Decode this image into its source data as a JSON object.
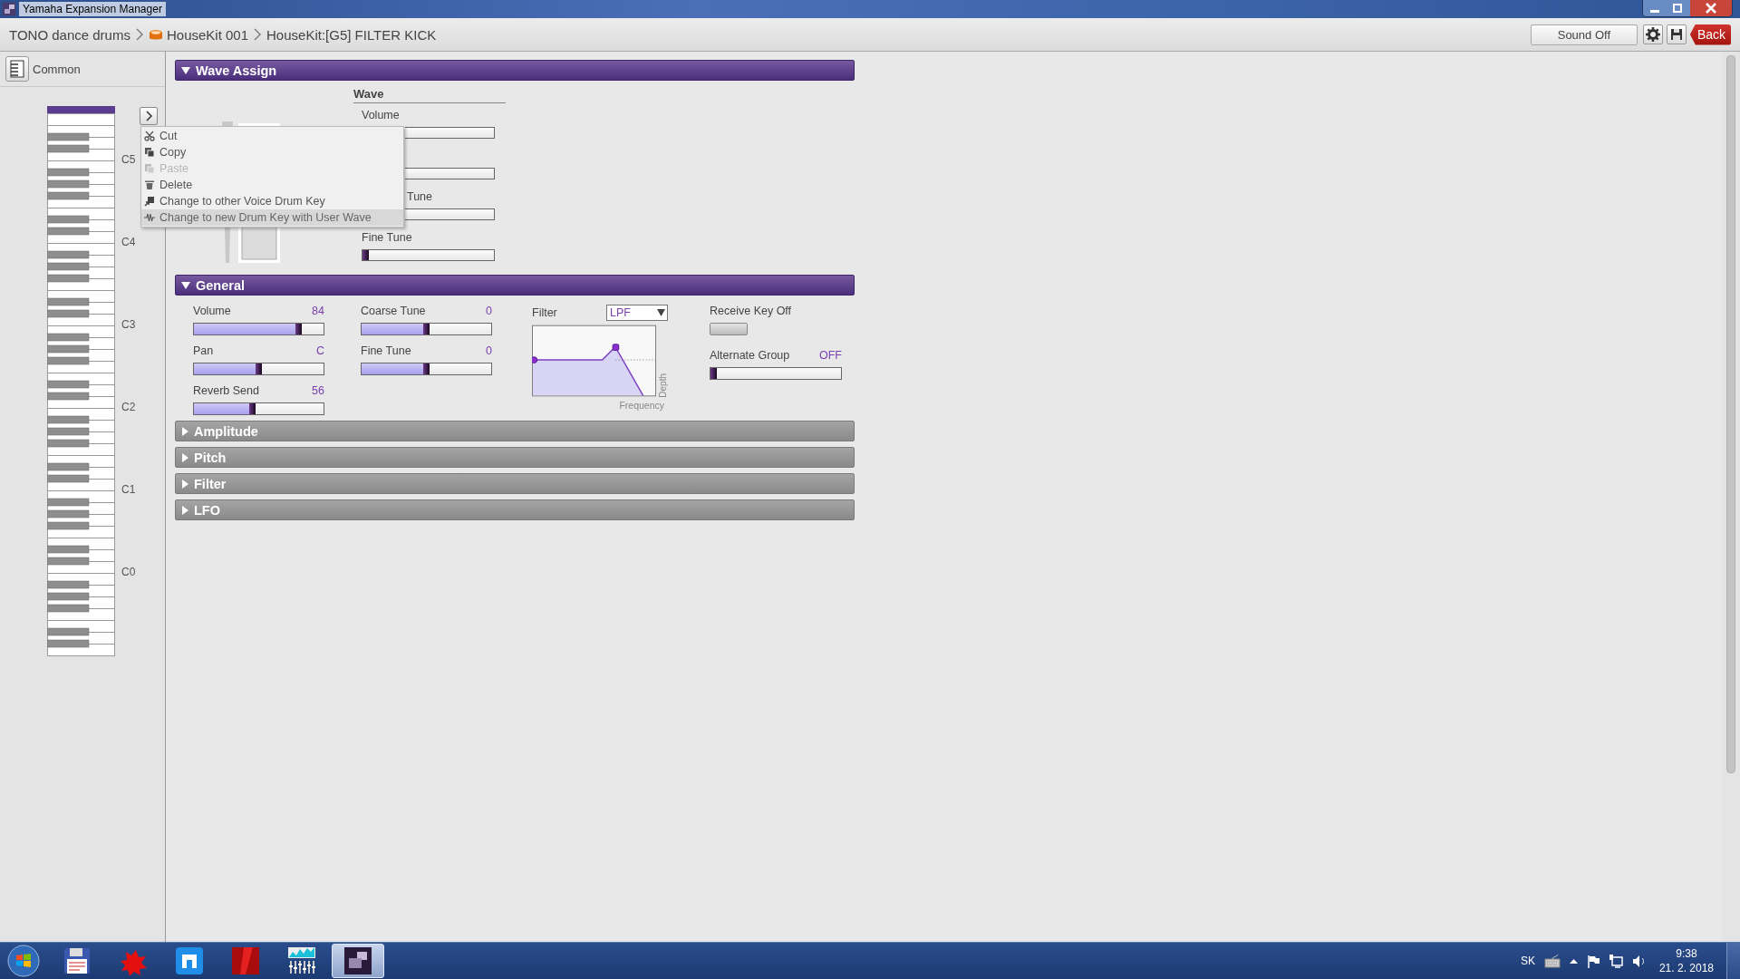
{
  "window": {
    "title": "Yamaha Expansion Manager"
  },
  "breadcrumb": [
    {
      "label": "TONO dance drums",
      "kind": "text"
    },
    {
      "label": "HouseKit 001",
      "kind": "drum"
    },
    {
      "label": "HouseKit:[G5] FILTER KICK",
      "kind": "text"
    }
  ],
  "toolbar": {
    "sound_button": "Sound Off",
    "back_button": "Back"
  },
  "sidebar": {
    "common_label": "Common",
    "octave_labels": [
      "C5",
      "C4",
      "C3",
      "C2",
      "C1",
      "C0"
    ]
  },
  "context_menu": {
    "items": [
      {
        "label": "Cut",
        "disabled": false,
        "highlighted": false
      },
      {
        "label": "Copy",
        "disabled": false,
        "highlighted": false
      },
      {
        "label": "Paste",
        "disabled": true,
        "highlighted": false
      },
      {
        "label": "Delete",
        "disabled": false,
        "highlighted": false
      },
      {
        "label": "Change to other Voice Drum Key",
        "disabled": false,
        "highlighted": false
      },
      {
        "label": "Change to new Drum Key with User Wave",
        "disabled": false,
        "highlighted": true
      }
    ]
  },
  "wave_assign": {
    "title": "Wave Assign",
    "expanded": true,
    "heading": "Wave",
    "sliders": [
      {
        "kind": "partial",
        "label": "Volume"
      },
      {
        "kind": "partial"
      },
      {
        "kind": "partial",
        "label": "Tune"
      },
      {
        "kind": "full",
        "label": "Fine Tune",
        "level": 0
      }
    ]
  },
  "general": {
    "title": "General",
    "expanded": true,
    "columns": [
      [
        {
          "label": "Volume",
          "reading": "84",
          "level": 0.82
        },
        {
          "label": "Pan",
          "reading": "C",
          "level": 0.5
        },
        {
          "label": "Reverb Send",
          "reading": "56",
          "level": 0.45
        }
      ],
      [
        {
          "label": "Coarse Tune",
          "reading": "0",
          "level": 0.5
        },
        {
          "label": "Fine Tune",
          "reading": "0",
          "level": 0.5
        }
      ]
    ],
    "filter": {
      "label": "Filter",
      "type": "LPF",
      "x_label": "Frequency",
      "y_label": "Depth"
    },
    "receive_key_off": {
      "label": "Receive Key Off",
      "on": false
    },
    "alternate_group": {
      "label": "Alternate Group",
      "reading": "OFF",
      "level": 0
    }
  },
  "sections": [
    {
      "title": "Amplitude",
      "expanded": false
    },
    {
      "title": "Pitch",
      "expanded": false
    },
    {
      "title": "Filter",
      "expanded": false
    },
    {
      "title": "LFO",
      "expanded": false
    }
  ],
  "taskbar": {
    "apps": [
      {
        "kind": "floppy",
        "selected": false
      },
      {
        "kind": "splat",
        "selected": false
      },
      {
        "kind": "blue",
        "selected": false
      },
      {
        "kind": "red",
        "selected": false
      },
      {
        "kind": "mixer",
        "selected": false
      },
      {
        "kind": "window",
        "selected": true
      }
    ],
    "tray": {
      "language": "SK",
      "time": "9:38",
      "date": "21. 2. 2018"
    }
  }
}
